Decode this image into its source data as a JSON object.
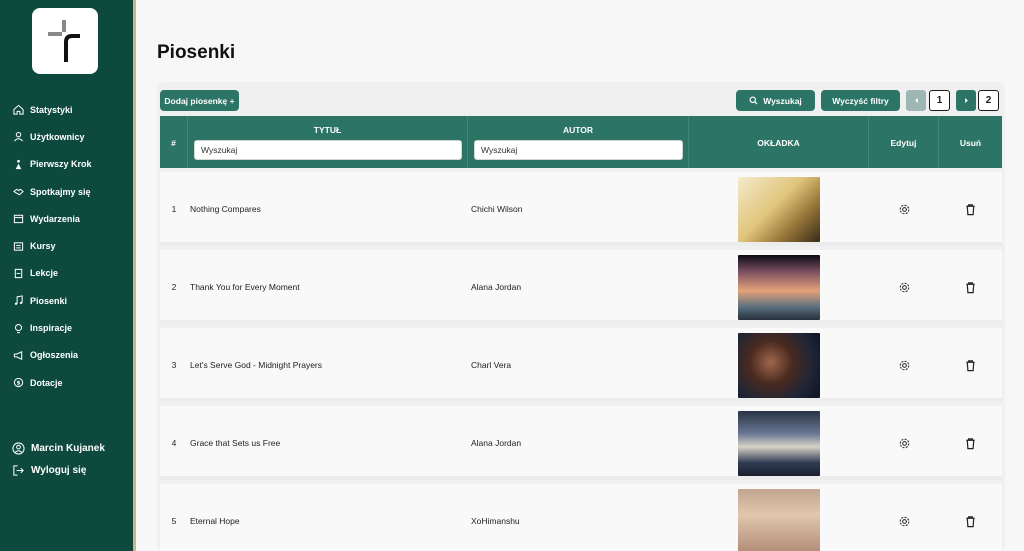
{
  "sidebar": {
    "items": [
      {
        "label": "Statystyki",
        "icon": "home-icon"
      },
      {
        "label": "Użytkownicy",
        "icon": "user-icon"
      },
      {
        "label": "Pierwszy Krok",
        "icon": "steps-icon"
      },
      {
        "label": "Spotkajmy się",
        "icon": "handshake-icon"
      },
      {
        "label": "Wydarzenia",
        "icon": "calendar-icon"
      },
      {
        "label": "Kursy",
        "icon": "courses-icon"
      },
      {
        "label": "Lekcje",
        "icon": "lesson-icon"
      },
      {
        "label": "Piosenki",
        "icon": "music-icon"
      },
      {
        "label": "Inspiracje",
        "icon": "lightbulb-icon"
      },
      {
        "label": "Ogłoszenia",
        "icon": "megaphone-icon"
      },
      {
        "label": "Dotacje",
        "icon": "coin-icon"
      }
    ],
    "user_name": "Marcin Kujanek",
    "logout_label": "Wyloguj się"
  },
  "page": {
    "title": "Piosenki"
  },
  "toolbar": {
    "add_label": "Dodaj piosenkę +",
    "search_label": "Wyszukaj",
    "clear_label": "Wyczyść filtry",
    "pages": [
      "1",
      "2"
    ]
  },
  "table": {
    "headers": {
      "num": "#",
      "title": "TYTUŁ",
      "author": "AUTOR",
      "cover": "OKŁADKA",
      "edit": "Edytuj",
      "delete": "Usuń"
    },
    "filters": {
      "title": "Wyszukaj",
      "author": "Wyszukaj"
    },
    "rows": [
      {
        "num": "1",
        "title": "Nothing Compares",
        "author": "Chichi Wilson"
      },
      {
        "num": "2",
        "title": "Thank You for Every Moment",
        "author": "Alana Jordan"
      },
      {
        "num": "3",
        "title": "Let's Serve God - Midnight Prayers",
        "author": "Charl Vera"
      },
      {
        "num": "4",
        "title": "Grace that Sets us Free",
        "author": "Alana Jordan"
      },
      {
        "num": "5",
        "title": "Eternal Hope",
        "author": "XoHimanshu"
      }
    ]
  },
  "colors": {
    "sidebar_bg": "#0d4a3d",
    "accent": "#2c7566",
    "sidebar_border": "#c9b98a"
  }
}
